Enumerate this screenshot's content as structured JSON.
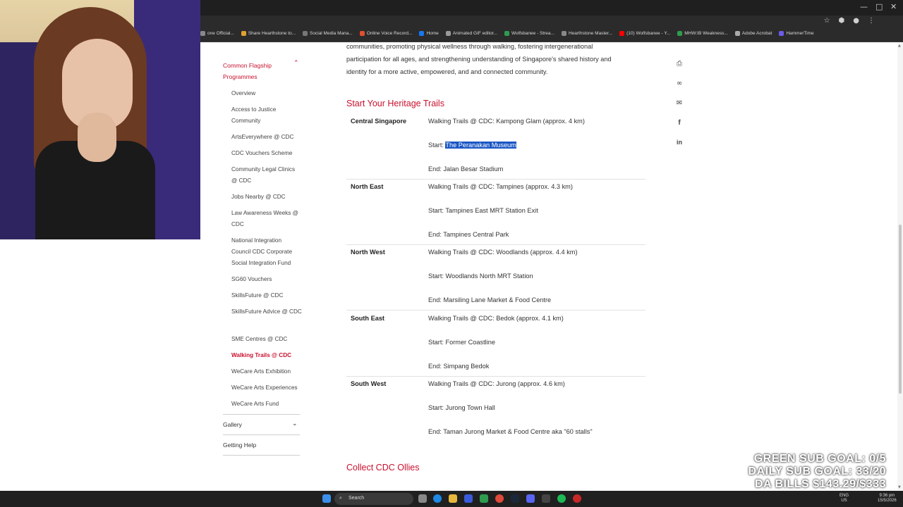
{
  "browser": {
    "window_controls": [
      "—",
      "□",
      "✕"
    ],
    "bookmarks": [
      {
        "label": "one Official...",
        "color": "#888888"
      },
      {
        "label": "Share Hearthstone to...",
        "color": "#e0a030"
      },
      {
        "label": "Social Media Mana...",
        "color": "#777777"
      },
      {
        "label": "Online Voice Record...",
        "color": "#e05030"
      },
      {
        "label": "Home",
        "color": "#1877f2"
      },
      {
        "label": "Animated GIF editor...",
        "color": "#999999"
      },
      {
        "label": "Wolfsbanee - Strea...",
        "color": "#2e9b4e"
      },
      {
        "label": "Hearthstone Master...",
        "color": "#888888"
      },
      {
        "label": "(10) Wolfsbanee - Y...",
        "color": "#ff0000"
      },
      {
        "label": "MHW:IB Weakness...",
        "color": "#2e9b4e"
      },
      {
        "label": "Adobe Acrobat",
        "color": "#aaaaaa"
      },
      {
        "label": "HammerTime",
        "color": "#6c5ce7"
      }
    ]
  },
  "sidebar": {
    "section_title": "Common Flagship Programmes",
    "items": [
      "Overview",
      "Access to Justice Community",
      "ArtsEverywhere @ CDC",
      "CDC Vouchers Scheme",
      "Community Legal Clinics @ CDC",
      "Jobs Nearby @ CDC",
      "Law Awareness Weeks @ CDC",
      "National Integration Council CDC Corporate Social Integration Fund",
      "SG60 Vouchers",
      "SkillsFuture @ CDC",
      "SkillsFuture Advice @ CDC",
      "SME Centres @ CDC",
      "Walking Trails @ CDC",
      "WeCare Arts Exhibition",
      "WeCare Arts Experiences",
      "WeCare Arts Fund"
    ],
    "active_item": "Walking Trails @ CDC",
    "gallery": "Gallery",
    "getting_help": "Getting Help",
    "accent_color": "#c8102e"
  },
  "content": {
    "intro_lines": [
      "communities, promoting physical wellness through walking, fostering intergenerational",
      "participation for all ages, and strengthening understanding of Singapore's shared history and",
      "identity for a more active, empowered, and and connected community."
    ],
    "heading": "Start Your Heritage Trails",
    "trails": [
      {
        "region": "Central Singapore",
        "trail": "Walking Trails @ CDC: Kampong Glam (approx. 4 km)",
        "start_prefix": "Start: ",
        "start": "The Peranakan Museum",
        "end": "End: Jalan Besar Stadium"
      },
      {
        "region": "North East",
        "trail": "Walking Trails @ CDC: Tampines (approx. 4.3 km)",
        "start_prefix": "Start: ",
        "start": "Tampines East MRT Station Exit",
        "end": "End: Tampines Central Park"
      },
      {
        "region": "North West",
        "trail": "Walking Trails @ CDC: Woodlands (approx. 4.4 km)",
        "start_prefix": "Start: ",
        "start": "Woodlands North MRT Station",
        "end": "End: Marsiling Lane Market & Food Centre"
      },
      {
        "region": "South East",
        "trail": "Walking Trails @ CDC: Bedok (approx. 4.1 km)",
        "start_prefix": "Start: ",
        "start": "Former Coastline",
        "end": "End: Simpang Bedok"
      },
      {
        "region": "South West",
        "trail": "Walking Trails @ CDC: Jurong (approx. 4.6 km)",
        "start_prefix": "Start: ",
        "start": "Jurong Town Hall",
        "end": "End: Taman Jurong Market & Food Centre aka \"60 stalls\""
      }
    ],
    "heading2": "Collect CDC Ollies",
    "share_icons": [
      "print-icon",
      "link-icon",
      "mail-icon",
      "facebook-icon",
      "linkedin-icon"
    ]
  },
  "overlay": {
    "lines": [
      "GREEN SUB GOAL: 0/5",
      "DAILY SUB GOAL: 33/20",
      "DA BILLS $143.29/$333"
    ]
  },
  "taskbar": {
    "search_label": "Search",
    "lang": "ENG",
    "region": "US",
    "time": "9:36 pm",
    "date": "15/5/2026"
  }
}
